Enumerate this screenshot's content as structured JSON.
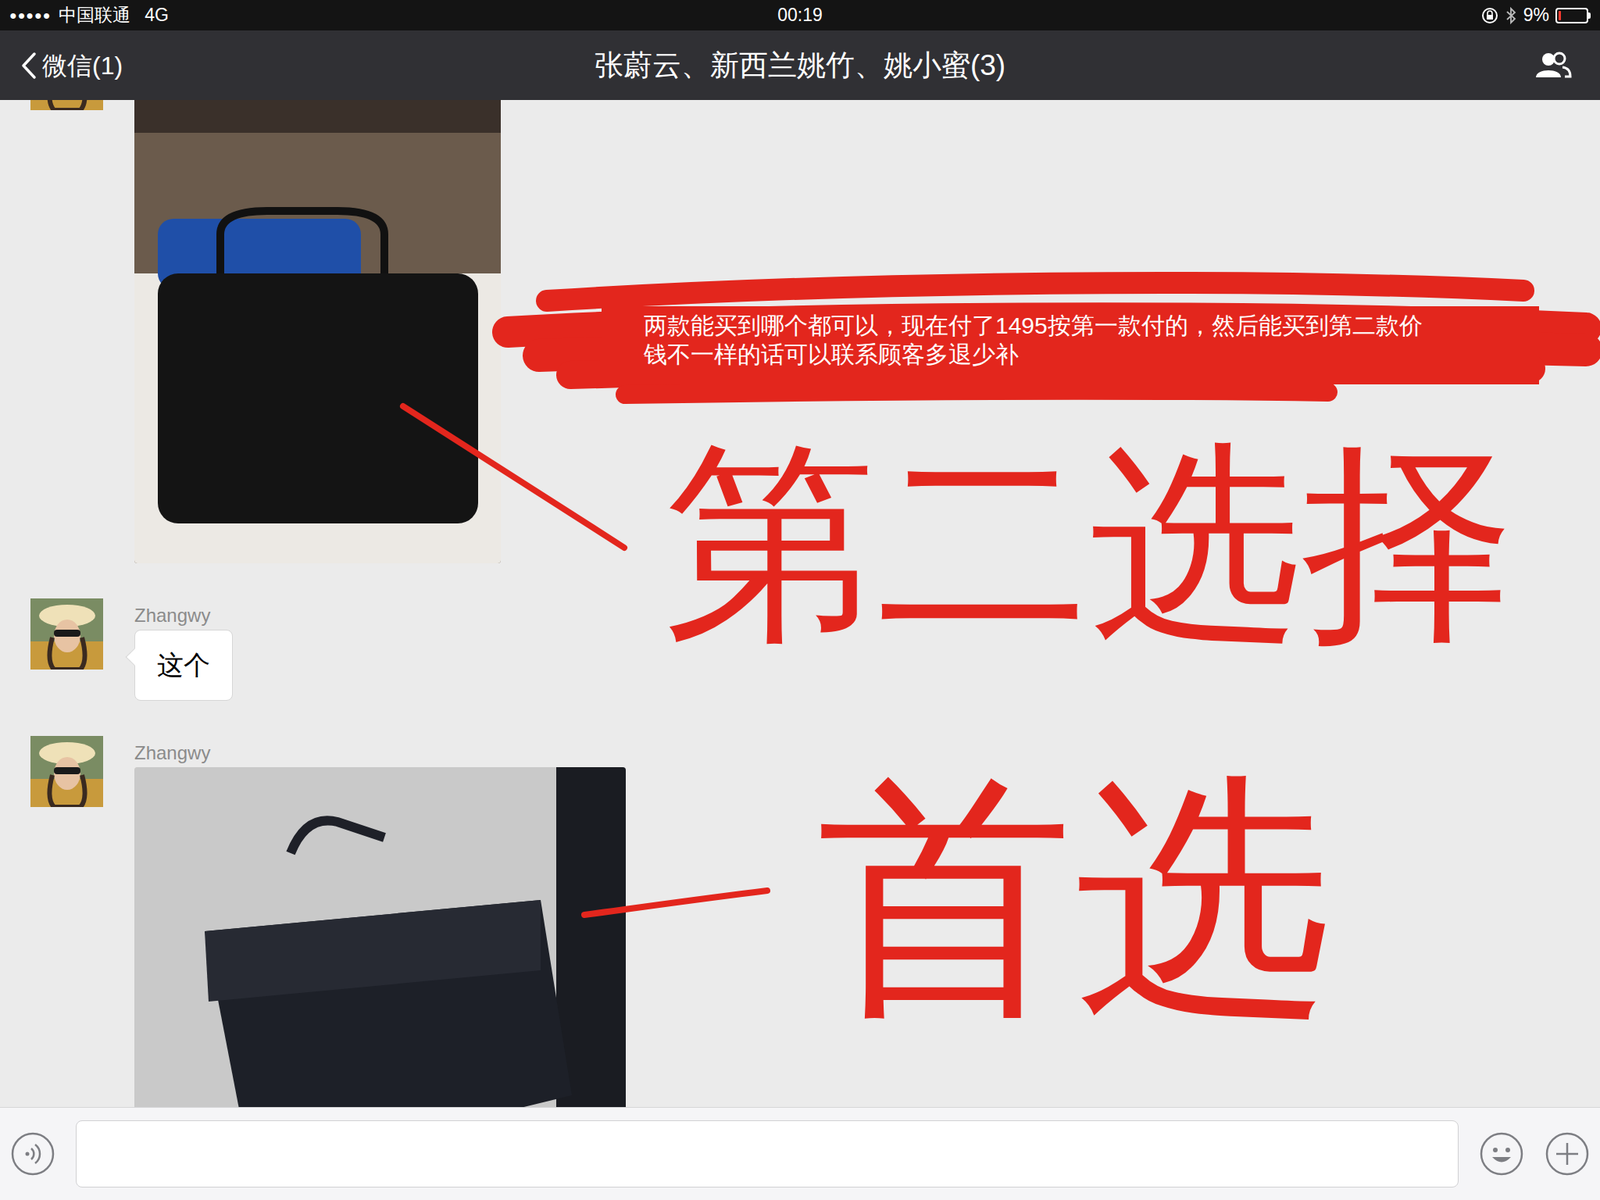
{
  "status_bar": {
    "signal": "●●●●●",
    "carrier": "中国联通",
    "network": "4G",
    "time": "00:19",
    "battery": "9%",
    "battery_level": 0.09
  },
  "nav": {
    "back": "微信(1)",
    "title": "张蔚云、新西兰姚竹、姚小蜜(3)"
  },
  "messages": [
    {
      "kind": "image",
      "sender": ""
    },
    {
      "kind": "text",
      "sender": "Zhangwy",
      "text": "这个"
    },
    {
      "kind": "image",
      "sender": "Zhangwy"
    }
  ],
  "annotations": {
    "note": [
      "两款能买到哪个都可以，现在付了1495按第一款付的，然后能买到第二款价",
      "钱不一样的话可以联系顾客多退少补"
    ],
    "second_choice": "第二选择",
    "first_choice": "首选"
  }
}
